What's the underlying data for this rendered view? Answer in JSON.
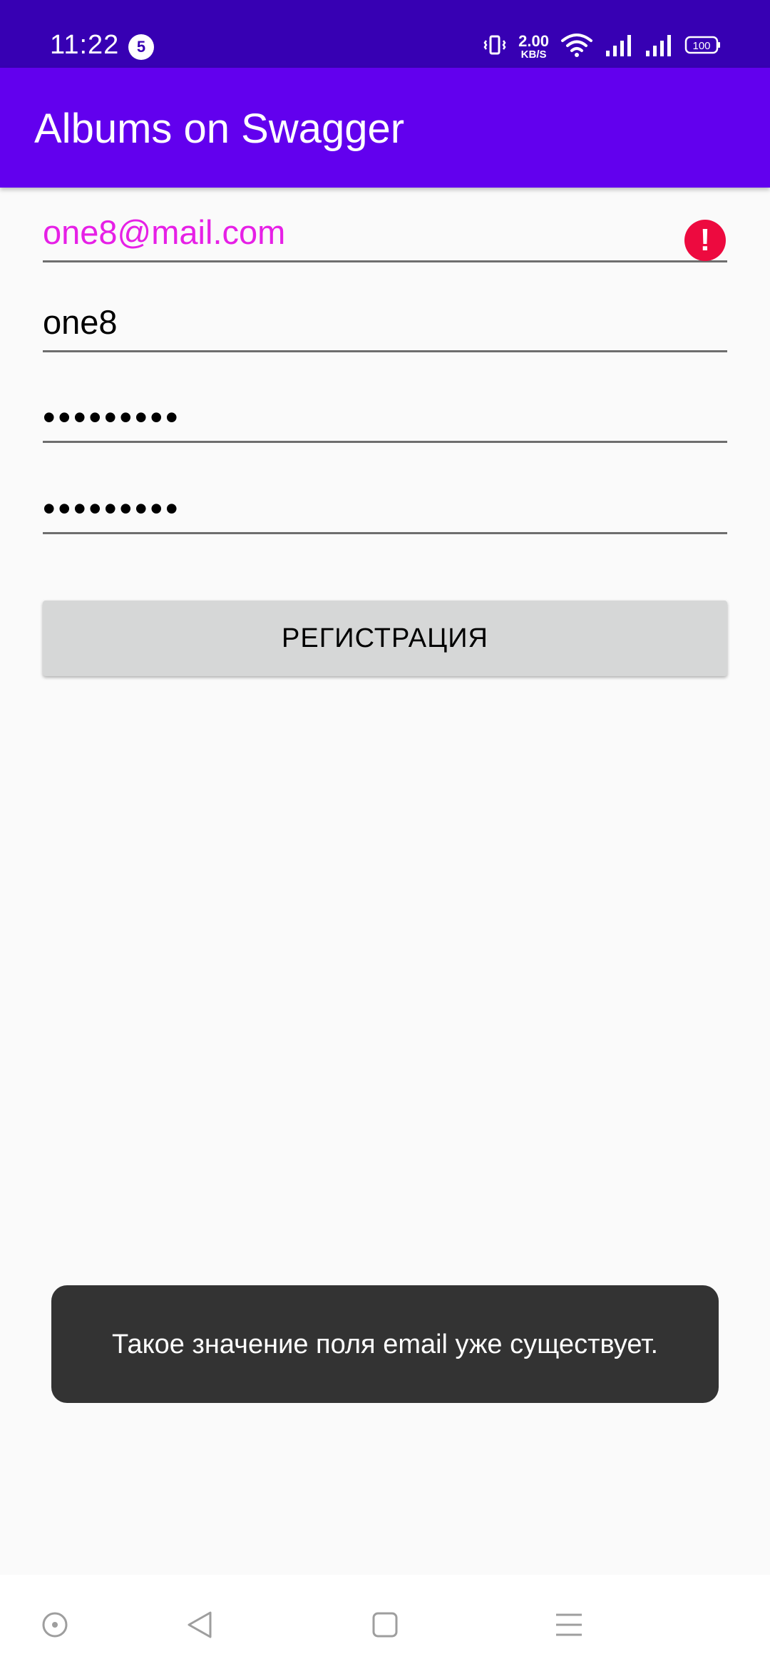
{
  "status_bar": {
    "time": "11:22",
    "notification_count": "5",
    "net_speed_value": "2.00",
    "net_speed_unit": "KB/S",
    "battery": "100"
  },
  "app_bar": {
    "title": "Albums on Swagger"
  },
  "form": {
    "email_value": "one8@mail.com",
    "username_value": "one8",
    "password_value": "•••••••••",
    "confirm_password_value": "•••••••••",
    "register_label": "РЕГИСТРАЦИЯ"
  },
  "toast": {
    "message": "Такое значение поля email уже существует."
  },
  "colors": {
    "status_bar": "#3700b3",
    "app_bar": "#6200ee",
    "error_text": "#e620e6",
    "error_icon": "#ed0a3f"
  },
  "nav_bar": {
    "icons": [
      "accessibility-icon",
      "back-icon",
      "home-icon",
      "menu-icon"
    ]
  }
}
